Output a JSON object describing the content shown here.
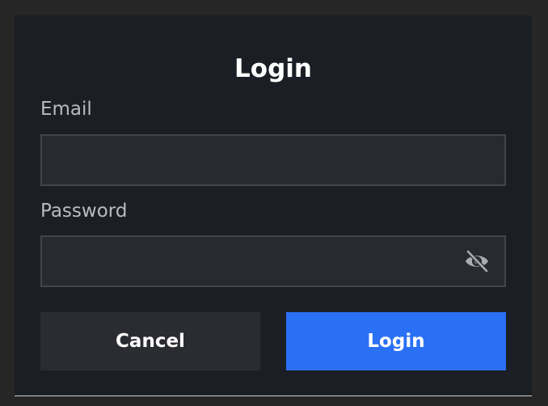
{
  "dialog": {
    "title": "Login"
  },
  "email": {
    "label": "Email",
    "value": "",
    "placeholder": ""
  },
  "password": {
    "label": "Password",
    "value": "",
    "placeholder": "",
    "toggle_icon": "eye-off-icon"
  },
  "buttons": {
    "cancel_label": "Cancel",
    "login_label": "Login"
  },
  "colors": {
    "page_background": "#262626",
    "dialog_background": "#1b1f25",
    "field_background": "#282a2f",
    "field_border": "#42454b",
    "cancel_background": "#2a2c31",
    "accent": "#2a70f5",
    "label_text": "#b9bbbf"
  }
}
